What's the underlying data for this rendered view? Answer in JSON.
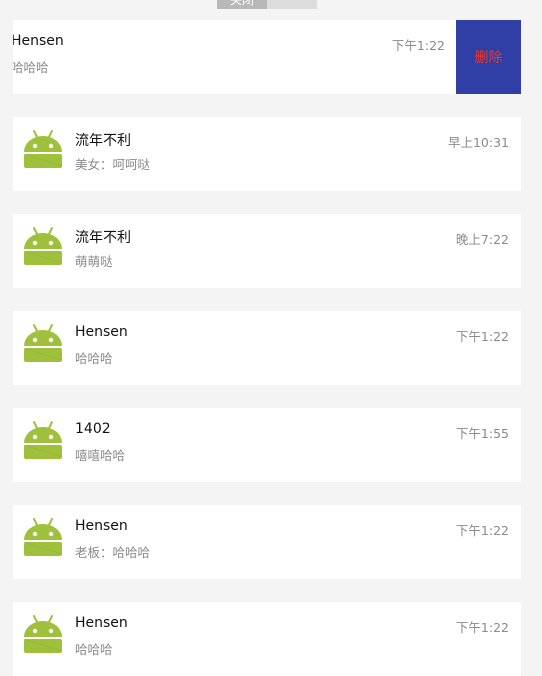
{
  "top_tab": {
    "label": "关闭"
  },
  "swiped_item": {
    "title": "Hensen",
    "subtitle": "哈哈哈",
    "time": "下午1:22",
    "delete_label": "删除"
  },
  "items": [
    {
      "title": "流年不利",
      "subtitle": "美女：呵呵哒",
      "time": "早上10:31"
    },
    {
      "title": "流年不利",
      "subtitle": "萌萌哒",
      "time": "晚上7:22"
    },
    {
      "title": "Hensen",
      "subtitle": "哈哈哈",
      "time": "下午1:22"
    },
    {
      "title": "1402",
      "subtitle": "嘻嘻哈哈",
      "time": "下午1:55"
    },
    {
      "title": "Hensen",
      "subtitle": "老板：哈哈哈",
      "time": "下午1:22"
    },
    {
      "title": "Hensen",
      "subtitle": "哈哈哈",
      "time": "下午1:22"
    }
  ],
  "avatar_icon": "android-icon",
  "colors": {
    "android_green": "#9fc03b",
    "delete_bg": "#303fa6",
    "delete_text": "#e03a3a",
    "page_bg": "#f4f4f4"
  }
}
